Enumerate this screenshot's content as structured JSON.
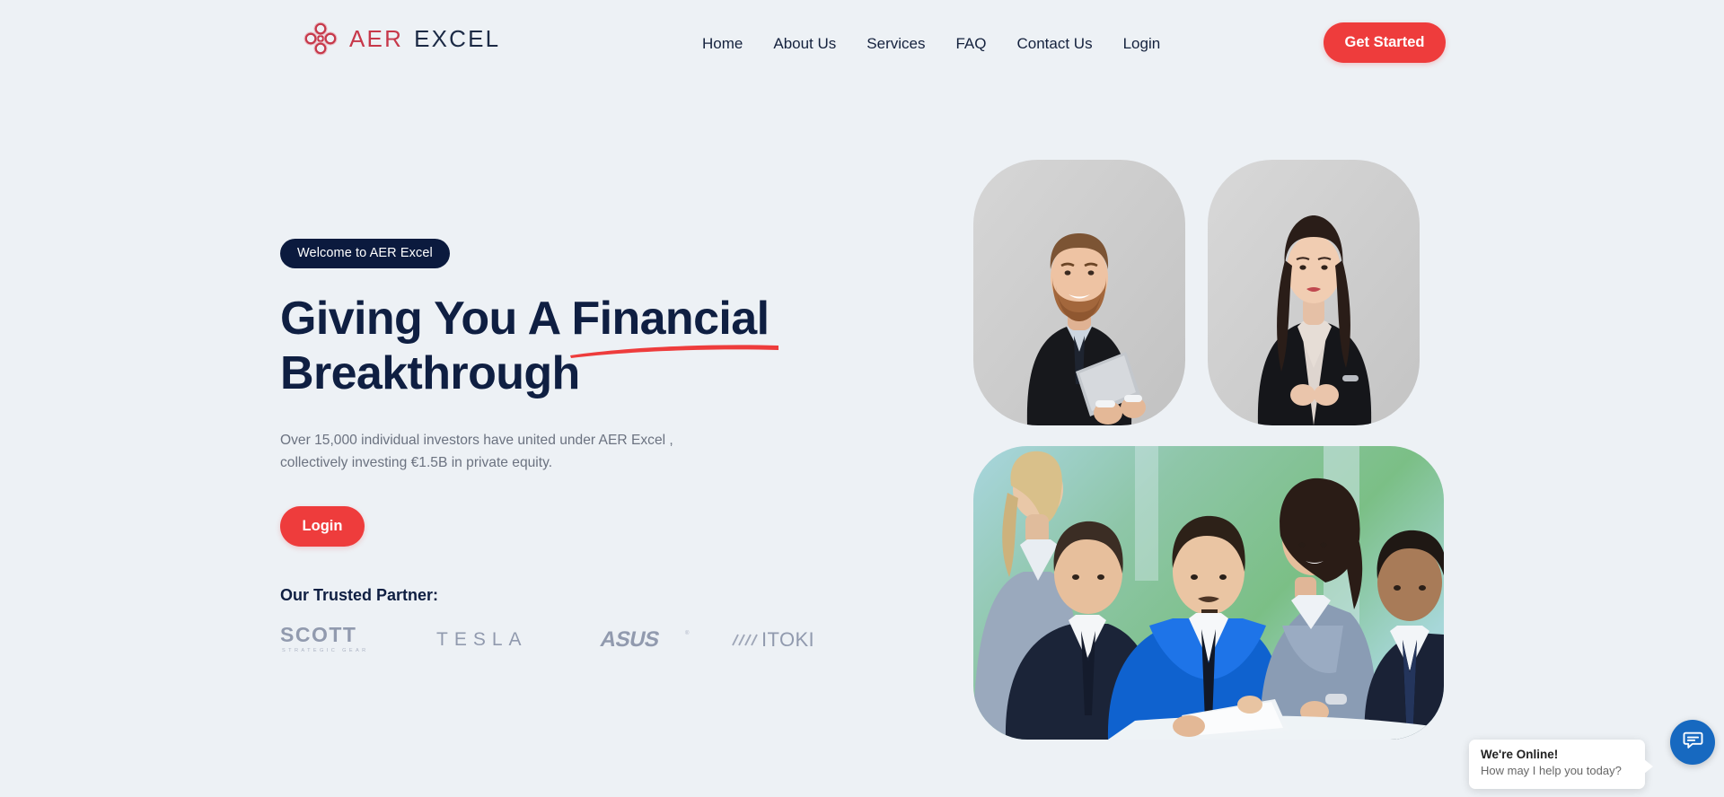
{
  "brand": {
    "logo_icon": "quatrefoil-clover-icon",
    "name_first": "AER",
    "name_second": "EXCEL",
    "accent_red": "#ee3c3c",
    "logo_red": "#c7384a",
    "navy": "#0f1f42",
    "page_background": "#edf1f5"
  },
  "header": {
    "nav": [
      {
        "label": "Home"
      },
      {
        "label": "About Us"
      },
      {
        "label": "Services"
      },
      {
        "label": "FAQ"
      },
      {
        "label": "Contact Us"
      },
      {
        "label": "Login"
      }
    ],
    "cta_label": "Get Started"
  },
  "hero": {
    "badge": "Welcome to AER Excel",
    "headline_part1": "Giving You A ",
    "headline_highlight": "Financial",
    "headline_part2": "Breakthrough",
    "subtext": "Over 15,000 individual investors have united under AER Excel , collectively investing €1.5B in private equity.",
    "login_label": "Login",
    "partners_title": "Our Trusted Partner:",
    "partners": [
      {
        "name": "SCOTT",
        "tagline": "STRATEGIC GEAR"
      },
      {
        "name": "TESLA",
        "tagline": ""
      },
      {
        "name": "ASUS",
        "tagline": ""
      },
      {
        "name": "ITOKI",
        "tagline": ""
      }
    ],
    "images": [
      {
        "alt": "businessman-portrait-photo"
      },
      {
        "alt": "businesswoman-portrait-photo"
      },
      {
        "alt": "business-team-meeting-photo"
      }
    ]
  },
  "chat_widget": {
    "title": "We're Online!",
    "subtitle": "How may I help you today?",
    "button_color": "#1769c0",
    "icon": "chat-bubble-icon"
  }
}
